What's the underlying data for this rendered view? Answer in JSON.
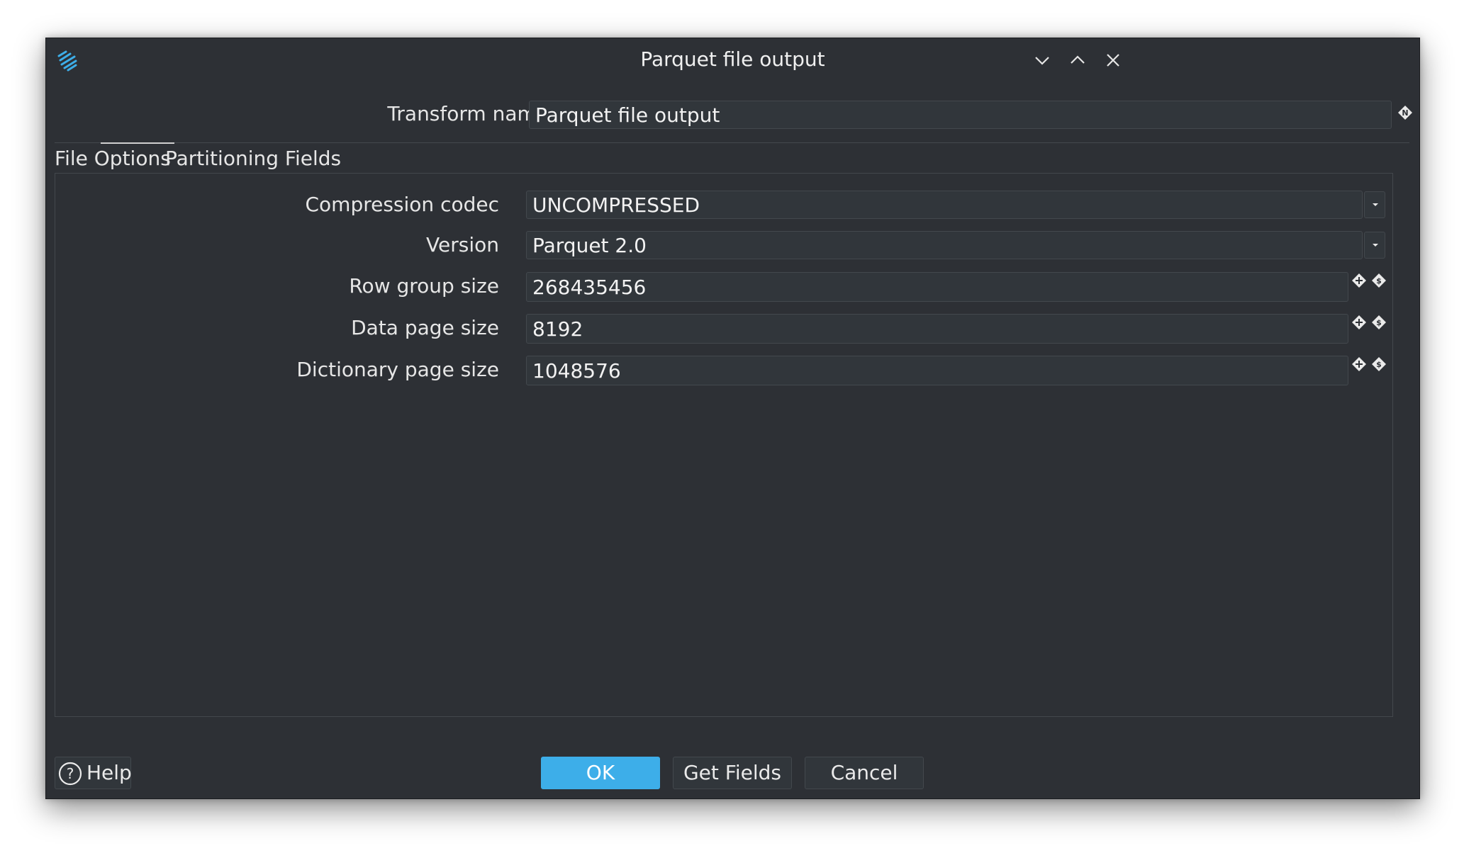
{
  "window": {
    "title": "Parquet file output"
  },
  "transform": {
    "label": "Transform name",
    "value": "Parquet file output"
  },
  "tabs": [
    {
      "label": "File Options",
      "active": true
    },
    {
      "label": "Partitioning Fields",
      "active": false
    }
  ],
  "fields": {
    "compression": {
      "label": "Compression codec",
      "value": "UNCOMPRESSED"
    },
    "version": {
      "label": "Version",
      "value": "Parquet 2.0"
    },
    "row_group": {
      "label": "Row group size",
      "value": "268435456"
    },
    "data_page": {
      "label": "Data page size",
      "value": "8192"
    },
    "dict_page": {
      "label": "Dictionary page size",
      "value": "1048576"
    }
  },
  "buttons": {
    "help": "Help",
    "ok": "OK",
    "get_fields": "Get Fields",
    "cancel": "Cancel"
  },
  "colors": {
    "accent": "#3daee9",
    "background": "#2d3035",
    "field": "#31363b"
  },
  "icons": {
    "app": "hop-app-icon",
    "minimize": "chevron-down-icon",
    "maximize": "chevron-up-icon",
    "close": "close-icon",
    "variable": "variable-icon",
    "password": "dollar-icon",
    "help": "help-circle-icon"
  }
}
